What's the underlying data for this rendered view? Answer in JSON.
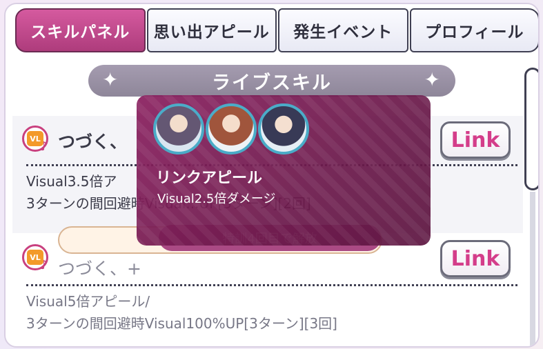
{
  "tabs": [
    {
      "label": "スキルパネル",
      "active": true
    },
    {
      "label": "思い出アピール",
      "active": false
    },
    {
      "label": "発生イベント",
      "active": false
    },
    {
      "label": "プロフィール",
      "active": false
    }
  ],
  "section": {
    "title": "ライブスキル"
  },
  "skills": [
    {
      "icon": "VL",
      "name": "つづく、",
      "link_label": "Link",
      "desc_line1": "Visual3.5倍ア",
      "desc_line2": "3ターンの間回避時Visual...UP[3ターン][2回]",
      "locked": false
    },
    {
      "icon": "VL",
      "name": "つづく、+",
      "link_label": "Link",
      "desc_line1": "Visual5倍アピール/",
      "desc_line2": "3ターンの間回避時Visual100%UP[3ターン][3回]",
      "locked": true
    }
  ],
  "unlock_text": "特訓4回目で解放",
  "popup": {
    "title": "リンクアピール",
    "desc": "Visual2.5倍ダメージ",
    "avatars": [
      "character-1",
      "character-2",
      "character-3"
    ]
  },
  "colors": {
    "accent": "#c9407f",
    "popup": "#7a1c55",
    "tab_active": "#c24c8d"
  }
}
